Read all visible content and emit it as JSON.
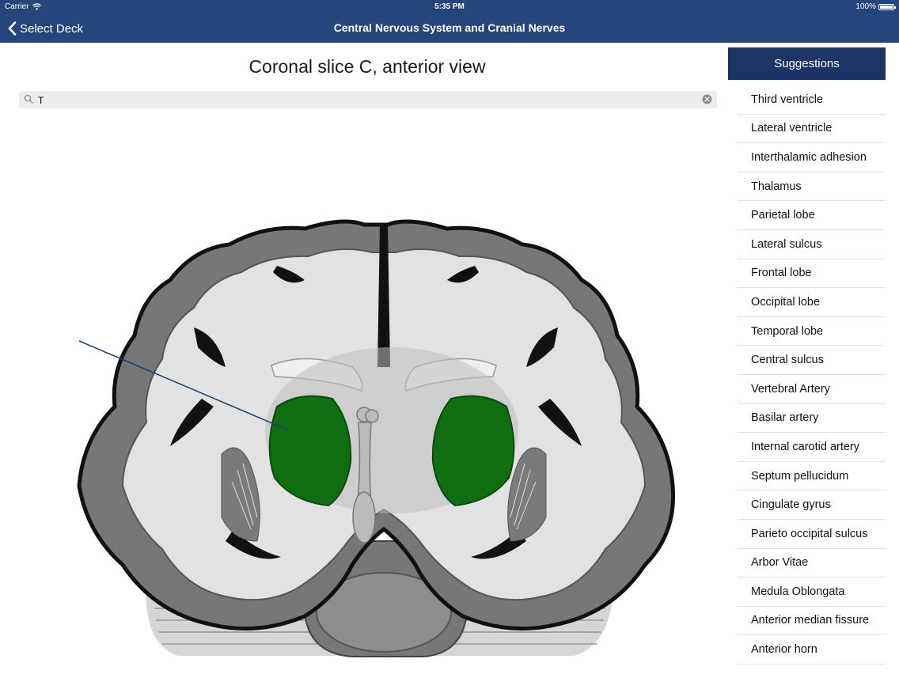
{
  "status_bar": {
    "carrier": "Carrier",
    "time": "5:35 PM",
    "battery": "100%"
  },
  "nav": {
    "back_label": "Select Deck",
    "title": "Central Nervous System and Cranial Nerves"
  },
  "main": {
    "title": "Coronal slice C, anterior view"
  },
  "search": {
    "value": "T",
    "placeholder": ""
  },
  "sidebar": {
    "header": "Suggestions",
    "items": [
      {
        "label": "Third ventricle"
      },
      {
        "label": "Lateral ventricle"
      },
      {
        "label": "Interthalamic adhesion"
      },
      {
        "label": "Thalamus"
      },
      {
        "label": "Parietal lobe"
      },
      {
        "label": "Lateral sulcus"
      },
      {
        "label": "Frontal lobe"
      },
      {
        "label": "Occipital lobe"
      },
      {
        "label": "Temporal lobe"
      },
      {
        "label": "Central sulcus"
      },
      {
        "label": "Vertebral Artery"
      },
      {
        "label": "Basilar artery"
      },
      {
        "label": "Internal carotid artery"
      },
      {
        "label": "Septum pellucidum"
      },
      {
        "label": "Cingulate gyrus"
      },
      {
        "label": "Parieto occipital sulcus"
      },
      {
        "label": "Arbor Vitae"
      },
      {
        "label": "Medula Oblongata"
      },
      {
        "label": "Anterior median fissure"
      },
      {
        "label": "Anterior horn"
      }
    ]
  },
  "colors": {
    "nav_bar": "#24467a",
    "sidebar_header": "#1a3566",
    "highlight_structure": "#0f6e12"
  },
  "icons": {
    "back": "chevron-left-icon",
    "search": "search-icon",
    "clear": "clear-icon",
    "wifi": "wifi-icon",
    "battery": "battery-icon"
  }
}
